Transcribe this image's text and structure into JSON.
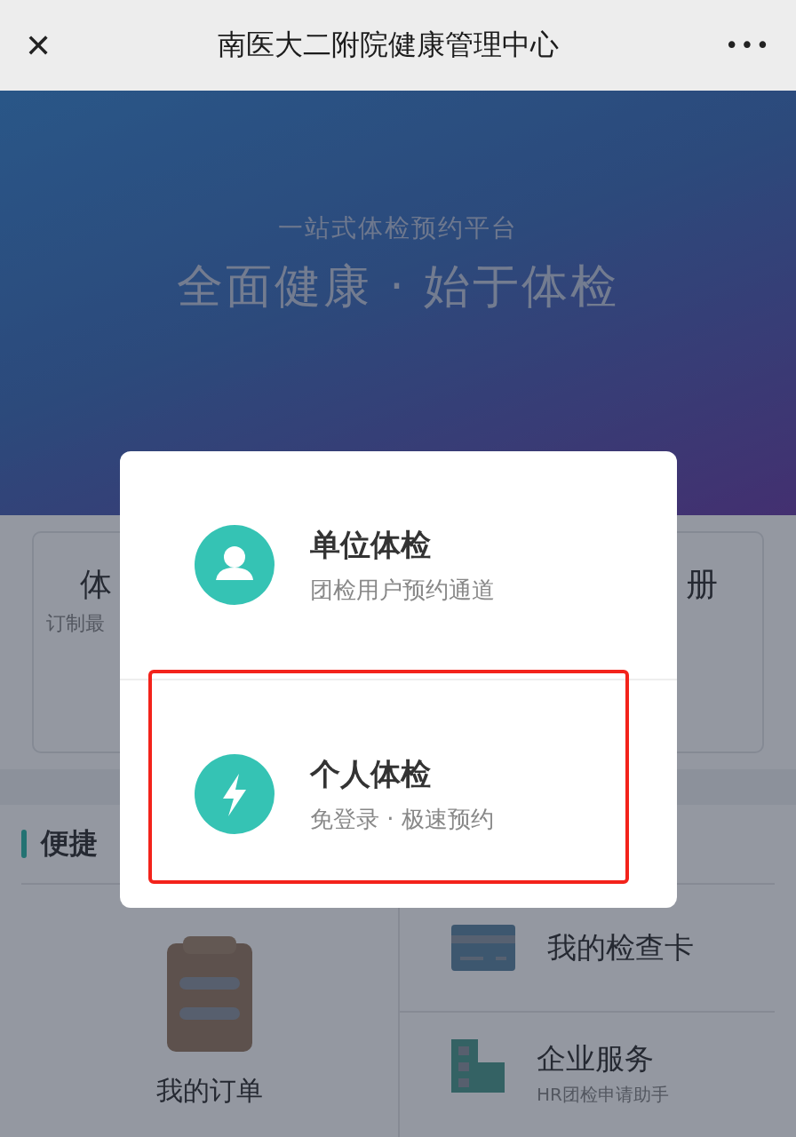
{
  "window": {
    "title": "南医大二附院健康管理中心",
    "close_icon": "✕",
    "more_icon": "•••"
  },
  "banner": {
    "subtitle": "一站式体检预约平台",
    "headline": "全面健康 · 始于体检"
  },
  "cards": [
    {
      "title": "体",
      "subtitle": "订制最"
    },
    {
      "title": "册"
    }
  ],
  "quick": {
    "title": "便捷",
    "items": [
      {
        "kind": "tall",
        "label": "我的订单"
      },
      {
        "kind": "row",
        "label": "我的检查卡"
      },
      {
        "kind": "row",
        "label": "企业服务",
        "note": "HR团检申请助手"
      }
    ]
  },
  "dialog": {
    "options": [
      {
        "kind": "person",
        "title": "单位体检",
        "subtitle": "团检用户预约通道",
        "highlighted": false
      },
      {
        "kind": "bolt",
        "title": "个人体检",
        "subtitle": "免登录 · 极速预约",
        "highlighted": true
      }
    ]
  }
}
